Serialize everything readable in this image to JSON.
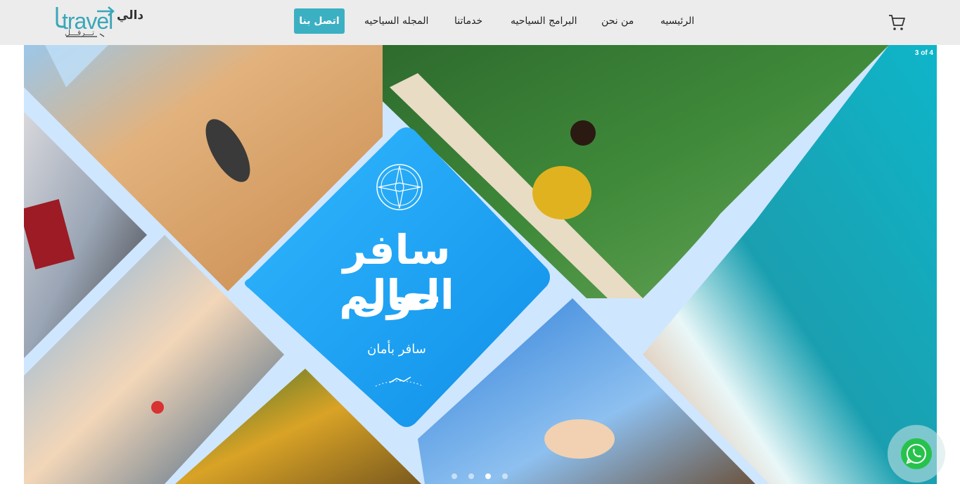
{
  "header": {
    "logo": {
      "latin": "travel",
      "arabic": "دالي",
      "subtitle": "تـــرفـــل"
    },
    "nav": {
      "home": "الرئيسيه",
      "about": "من نحن",
      "programs": "البرامج السياحيه",
      "services": "خدماتنا",
      "magazine": "المجله السياحيه",
      "contact": "اتصل بنا"
    },
    "cart_icon": "shopping-cart-icon"
  },
  "slider": {
    "counter": "3 of 4",
    "headline_line1": "سافر حول",
    "headline_line2": "العالم",
    "tagline": "سافر بأمان",
    "dots_total": 4,
    "active_index": 2
  },
  "colors": {
    "accent": "#3bb0c2",
    "header_bg": "#ececec",
    "diamond_blue": "#1aa3f5",
    "whatsapp": "#27c24c"
  },
  "floating": {
    "whatsapp_icon": "whatsapp-icon"
  }
}
